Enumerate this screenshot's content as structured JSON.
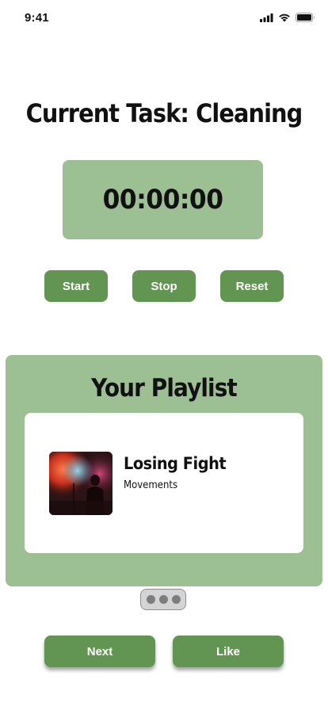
{
  "status_bar": {
    "time": "9:41",
    "icons": [
      "signal-icon",
      "wifi-icon",
      "battery-icon"
    ]
  },
  "title": "Current Task: Cleaning",
  "timer": {
    "display": "00:00:00"
  },
  "controls": {
    "start_label": "Start",
    "stop_label": "Stop",
    "reset_label": "Reset"
  },
  "playlist": {
    "heading": "Your Playlist",
    "track": {
      "title": "Losing Fight",
      "artist": "Movements",
      "art_icon": "album-art-concert-photo"
    },
    "more_icon": "more-dots-icon"
  },
  "actions": {
    "next_label": "Next",
    "like_label": "Like"
  },
  "colors": {
    "panel_green": "#9cbf94",
    "button_green": "#629551",
    "text": "#111111",
    "white": "#ffffff"
  }
}
